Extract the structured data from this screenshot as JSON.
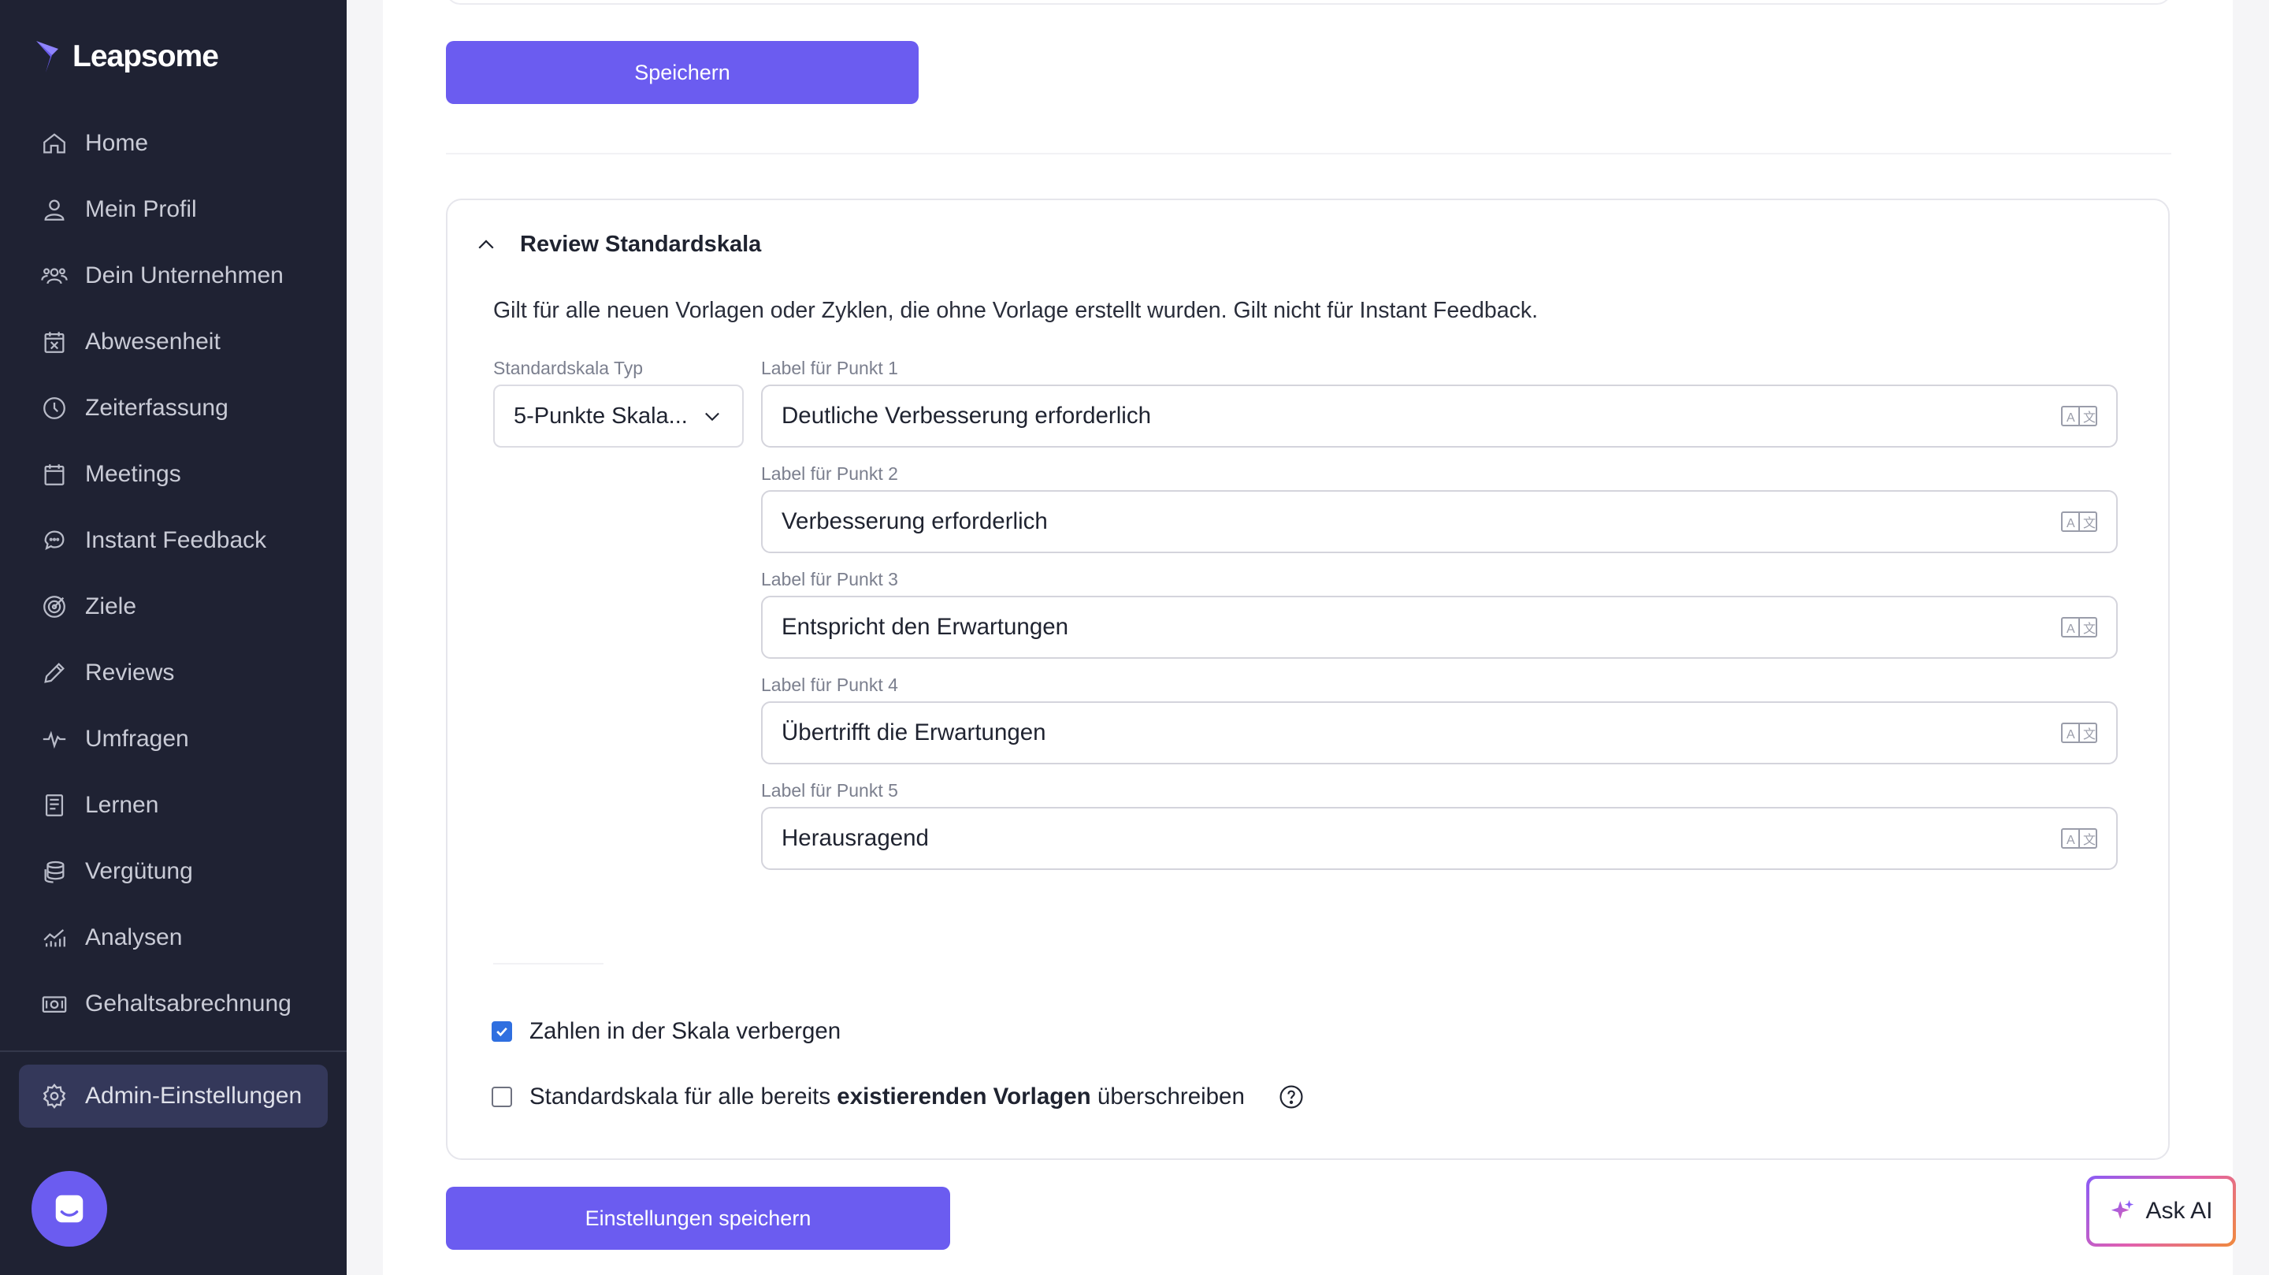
{
  "brand": {
    "name": "Leapsome",
    "accent": "#6b5cf0",
    "sidebar_bg": "#1f2233"
  },
  "sidebar": {
    "items": [
      {
        "label": "Home",
        "icon": "home-icon"
      },
      {
        "label": "Mein Profil",
        "icon": "user-icon"
      },
      {
        "label": "Dein Unternehmen",
        "icon": "team-icon"
      },
      {
        "label": "Abwesenheit",
        "icon": "calendar-x-icon"
      },
      {
        "label": "Zeiterfassung",
        "icon": "clock-icon"
      },
      {
        "label": "Meetings",
        "icon": "calendar-icon"
      },
      {
        "label": "Instant Feedback",
        "icon": "chat-icon"
      },
      {
        "label": "Ziele",
        "icon": "target-icon"
      },
      {
        "label": "Reviews",
        "icon": "pencil-icon"
      },
      {
        "label": "Umfragen",
        "icon": "pulse-icon"
      },
      {
        "label": "Lernen",
        "icon": "book-icon"
      },
      {
        "label": "Vergütung",
        "icon": "coins-icon"
      },
      {
        "label": "Analysen",
        "icon": "chart-icon"
      },
      {
        "label": "Gehaltsabrechnung",
        "icon": "money-icon"
      }
    ],
    "admin_label": "Admin-Einstellungen"
  },
  "top": {
    "save_label": "Speichern"
  },
  "section": {
    "title": "Review Standardskala",
    "description": "Gilt für alle neuen Vorlagen oder Zyklen, die ohne Vorlage erstellt wurden. Gilt nicht für Instant Feedback.",
    "scale_type_label": "Standardskala Typ",
    "scale_type_value": "5-Punkte Skala...",
    "points": [
      {
        "label": "Label für Punkt 1",
        "value": "Deutliche Verbesserung erforderlich"
      },
      {
        "label": "Label für Punkt 2",
        "value": "Verbesserung erforderlich"
      },
      {
        "label": "Label für Punkt 3",
        "value": "Entspricht den Erwartungen"
      },
      {
        "label": "Label für Punkt 4",
        "value": "Übertrifft die Erwartungen"
      },
      {
        "label": "Label für Punkt 5",
        "value": "Herausragend"
      }
    ],
    "hide_numbers": {
      "label": "Zahlen in der Skala verbergen",
      "checked": true
    },
    "override": {
      "label_before": "Standardskala für alle bereits ",
      "label_bold": "existierenden Vorlagen",
      "label_after": " überschreiben",
      "checked": false
    }
  },
  "bottom": {
    "save_label": "Einstellungen speichern"
  },
  "ask_ai": {
    "label": "Ask AI"
  }
}
